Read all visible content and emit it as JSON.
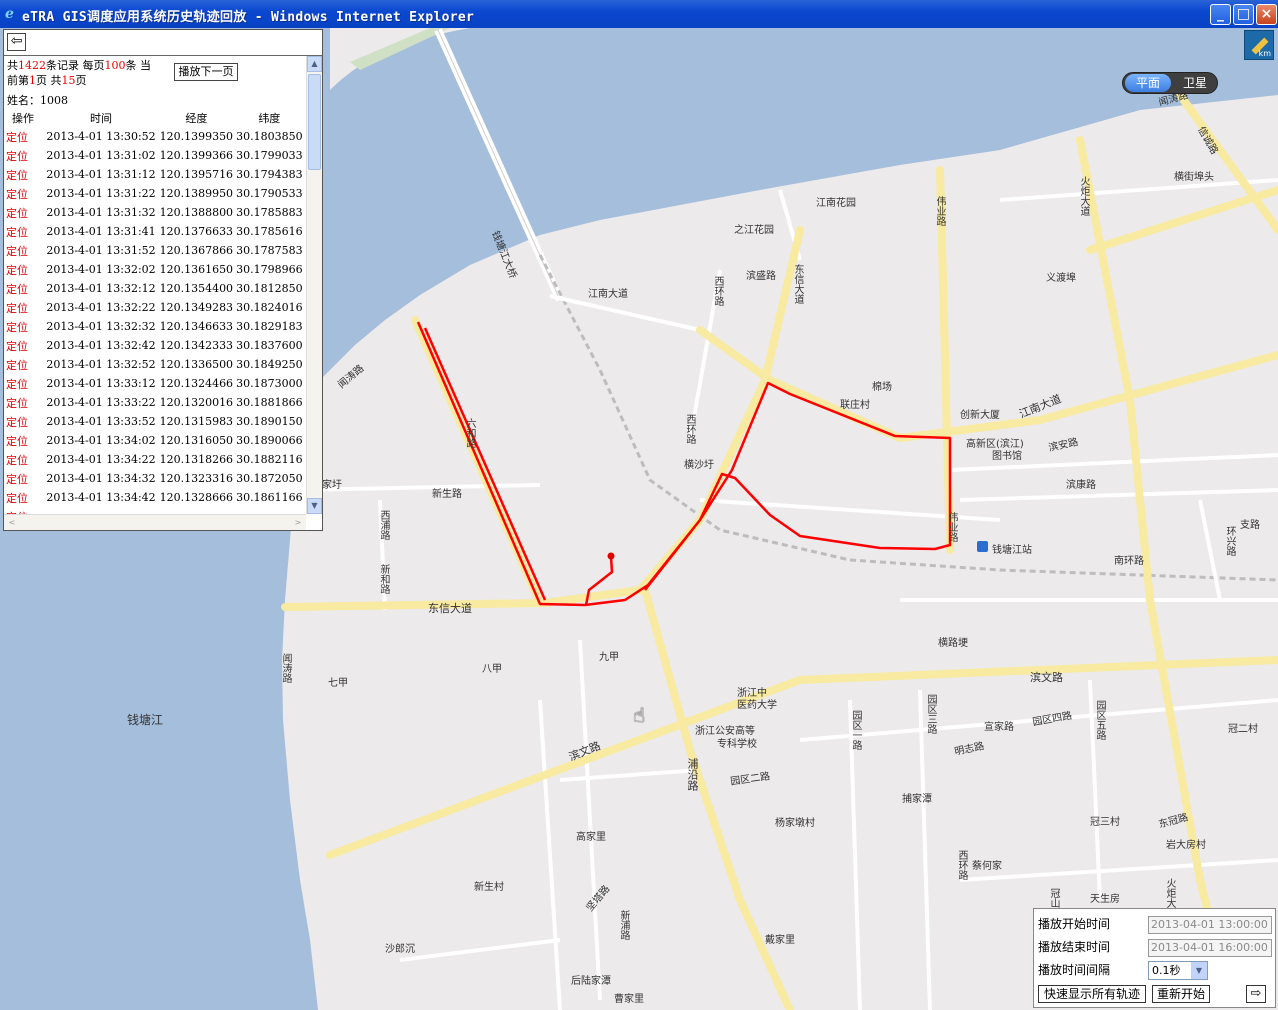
{
  "window": {
    "title": "eTRA GIS调度应用系统历史轨迹回放 - Windows Internet Explorer",
    "browser_icon": "ie-icon",
    "controls": [
      "minimize",
      "maximize",
      "close"
    ]
  },
  "map": {
    "type_toggle": {
      "plane": "平面",
      "satellite": "卫星",
      "selected": "平面"
    },
    "ruler_label": "km",
    "colors": {
      "land": "#eceaea",
      "water": "#a5bedc",
      "road_major": "#f8eaa0",
      "track": "#ff0000"
    },
    "labels": {
      "qiantangjiang": "钱塘江",
      "qiantangjiang_bridge": "钱塘江大桥",
      "wentao_top": "闻涛路",
      "wentao_left": "闻涛路",
      "wentao_sw": "闻涛路",
      "xinchenglu": "信诚路",
      "hengjiebu": "横街埠头",
      "huoju": "火炬大道",
      "huoju_s": "火炬大道",
      "jiangnan_garden": "江南花园",
      "zhijiang_garden": "之江花园",
      "weiye": "伟业路",
      "weiye_s": "伟业路",
      "dongxin": "东信大道",
      "dongxin_w": "东信大道",
      "binsheng": "滨盛路",
      "xihuan": "西环路",
      "xihuan_s": "西环路",
      "jiangnan_ave": "江南大道",
      "jiangnan_ave_e": "江南大道",
      "yiduobu": "义渡埠",
      "mianchang": "棉场",
      "lianzhuang": "联庄村",
      "chuangxin": "创新大厦",
      "gaoxin_lib_1": "高新区(滨江)",
      "gaoxin_lib_2": "图书馆",
      "binan": "滨安路",
      "binkang": "滨康路",
      "liuhe": "六和路",
      "hengshayu": "横沙圩",
      "jiajiayu": "家圩",
      "xinsheng": "新生路",
      "xipu": "西浦路",
      "xinhe": "新和路",
      "qiantang_station": "钱塘江站",
      "nanhuan": "南环路",
      "zhibu": "支路",
      "huanxing": "环兴路",
      "hengluge": "横路埂",
      "binwen_e": "滨文路",
      "binwen_w": "滨文路",
      "bajia": "八甲",
      "jiujia": "九甲",
      "qijia": "七甲",
      "tcm_univ_1": "浙江中",
      "tcm_univ_2": "医药大学",
      "police_1": "浙江公安高等",
      "police_2": "专科学校",
      "yuanqu1": "园区一路",
      "yuanqu2": "园区二路",
      "yuanqu3": "园区三路",
      "yuanqu4": "园区四路",
      "yuanqu5": "园区五路",
      "xuanjia": "宣家路",
      "mingzhi": "明志路",
      "guanerc": "冠二村",
      "puyan": "浦沿路",
      "pujiatan": "捕家潭",
      "yangjiadun": "杨家墩村",
      "guansan": "冠三村",
      "donguan": "东冠路",
      "yandafang": "岩大房村",
      "gaojiali": "高家里",
      "xinshengcun": "新生村",
      "caihejia": "蔡何家",
      "xihuan2": "西环路",
      "tiansheng": "天生房",
      "jiangu": "坚塔路",
      "xinpu": "新浦路",
      "shalangchen": "沙郎沉",
      "daijiali": "戴家里",
      "houlu": "后陆家潭",
      "caojiali": "曹家里",
      "guan_s": "冠山路"
    }
  },
  "records_panel": {
    "back_icon": "arrow-left-icon",
    "summary": {
      "p1": "共",
      "total": "1422",
      "p2": "条记录 每页",
      "per_page": "100",
      "p3": "条 当",
      "p4": "前第",
      "current_page": "1",
      "p5": "页 共",
      "pages": "15",
      "p6": "页"
    },
    "next_page_button": "播放下一页",
    "name_label": "姓名：",
    "name_value": "1008",
    "columns": [
      "操作",
      "时间",
      "经度",
      "纬度"
    ],
    "rows": [
      {
        "op": "定位",
        "time": "2013-4-01 13:30:52",
        "lng": "120.1399350",
        "lat": "30.1803850"
      },
      {
        "op": "定位",
        "time": "2013-4-01 13:31:02",
        "lng": "120.1399366",
        "lat": "30.1799033"
      },
      {
        "op": "定位",
        "time": "2013-4-01 13:31:12",
        "lng": "120.1395716",
        "lat": "30.1794383"
      },
      {
        "op": "定位",
        "time": "2013-4-01 13:31:22",
        "lng": "120.1389950",
        "lat": "30.1790533"
      },
      {
        "op": "定位",
        "time": "2013-4-01 13:31:32",
        "lng": "120.1388800",
        "lat": "30.1785883"
      },
      {
        "op": "定位",
        "time": "2013-4-01 13:31:41",
        "lng": "120.1376633",
        "lat": "30.1785616"
      },
      {
        "op": "定位",
        "time": "2013-4-01 13:31:52",
        "lng": "120.1367866",
        "lat": "30.1787583"
      },
      {
        "op": "定位",
        "time": "2013-4-01 13:32:02",
        "lng": "120.1361650",
        "lat": "30.1798966"
      },
      {
        "op": "定位",
        "time": "2013-4-01 13:32:12",
        "lng": "120.1354400",
        "lat": "30.1812850"
      },
      {
        "op": "定位",
        "time": "2013-4-01 13:32:22",
        "lng": "120.1349283",
        "lat": "30.1824016"
      },
      {
        "op": "定位",
        "time": "2013-4-01 13:32:32",
        "lng": "120.1346633",
        "lat": "30.1829183"
      },
      {
        "op": "定位",
        "time": "2013-4-01 13:32:42",
        "lng": "120.1342333",
        "lat": "30.1837600"
      },
      {
        "op": "定位",
        "time": "2013-4-01 13:32:52",
        "lng": "120.1336500",
        "lat": "30.1849250"
      },
      {
        "op": "定位",
        "time": "2013-4-01 13:33:12",
        "lng": "120.1324466",
        "lat": "30.1873000"
      },
      {
        "op": "定位",
        "time": "2013-4-01 13:33:22",
        "lng": "120.1320016",
        "lat": "30.1881866"
      },
      {
        "op": "定位",
        "time": "2013-4-01 13:33:52",
        "lng": "120.1315983",
        "lat": "30.1890150"
      },
      {
        "op": "定位",
        "time": "2013-4-01 13:34:02",
        "lng": "120.1316050",
        "lat": "30.1890066"
      },
      {
        "op": "定位",
        "time": "2013-4-01 13:34:22",
        "lng": "120.1318266",
        "lat": "30.1882116"
      },
      {
        "op": "定位",
        "time": "2013-4-01 13:34:32",
        "lng": "120.1323316",
        "lat": "30.1872050"
      },
      {
        "op": "定位",
        "time": "2013-4-01 13:34:42",
        "lng": "120.1328666",
        "lat": "30.1861166"
      }
    ],
    "partial_row_op": "定位"
  },
  "playback": {
    "start_label": "播放开始时间",
    "start_value": "2013-04-01 13:00:00",
    "end_label": "播放结束时间",
    "end_value": "2013-04-01 16:00:00",
    "interval_label": "播放时间间隔",
    "interval_value": "0.1秒",
    "show_all_button": "快速显示所有轨迹",
    "restart_button": "重新开始",
    "next_icon": "arrow-right-icon"
  }
}
